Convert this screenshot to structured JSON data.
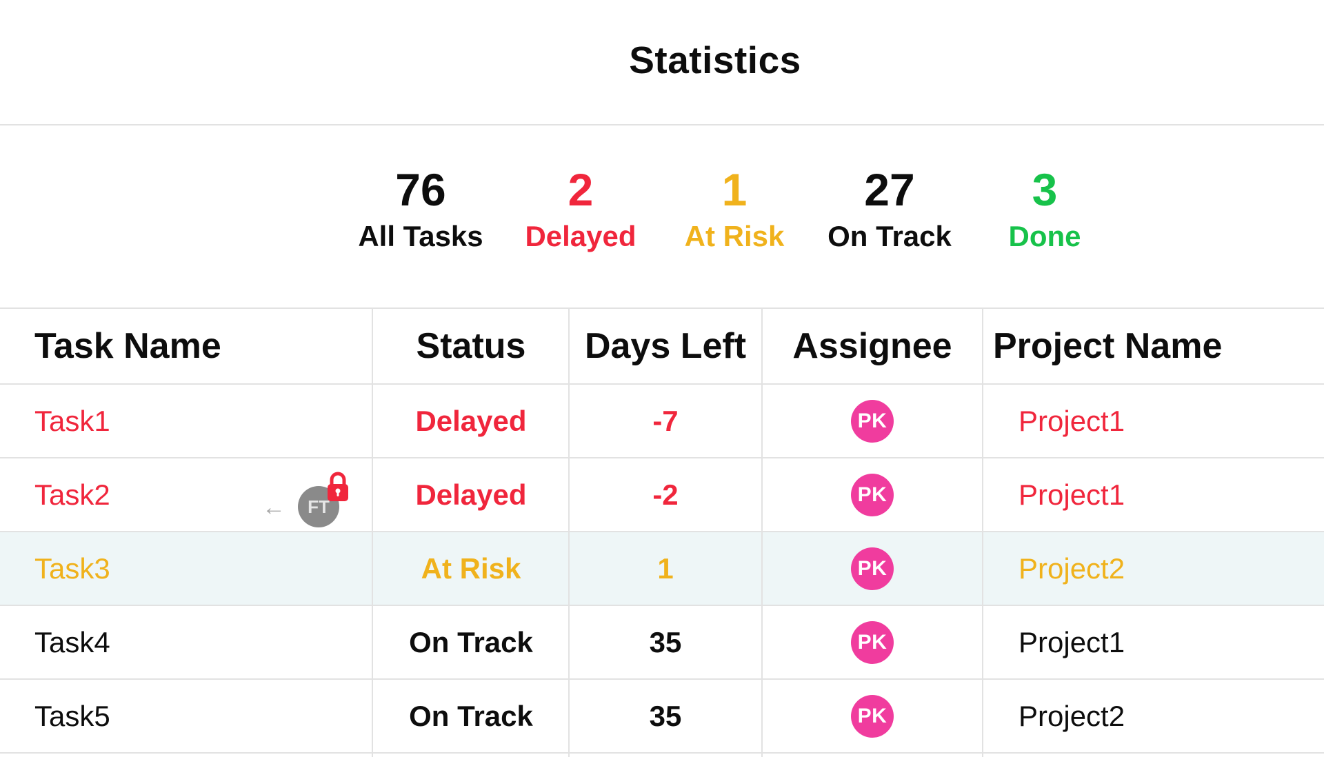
{
  "title": "Statistics",
  "colors": {
    "delayed": "#f0263c",
    "at_risk": "#f0b21c",
    "done": "#17c24a",
    "default": "#0d0d0d",
    "avatar": "#f03c9e",
    "highlight_row": "#eef6f7"
  },
  "stats": [
    {
      "value": "76",
      "label": "All Tasks"
    },
    {
      "value": "2",
      "label": "Delayed"
    },
    {
      "value": "1",
      "label": "At Risk"
    },
    {
      "value": "27",
      "label": "On Track"
    },
    {
      "value": "3",
      "label": "Done"
    }
  ],
  "table": {
    "columns": [
      "Task Name",
      "Status",
      "Days Left",
      "Assignee",
      "Project Name"
    ],
    "rows": [
      {
        "task": "Task1",
        "status": "Delayed",
        "days_left": "-7",
        "assignee": "PK",
        "project": "Project1"
      },
      {
        "task": "Task2",
        "status": "Delayed",
        "days_left": "-2",
        "assignee": "PK",
        "project": "Project1",
        "dependency_badge": "FT"
      },
      {
        "task": "Task3",
        "status": "At Risk",
        "days_left": "1",
        "assignee": "PK",
        "project": "Project2"
      },
      {
        "task": "Task4",
        "status": "On Track",
        "days_left": "35",
        "assignee": "PK",
        "project": "Project1"
      },
      {
        "task": "Task5",
        "status": "On Track",
        "days_left": "35",
        "assignee": "PK",
        "project": "Project2"
      }
    ]
  },
  "icons": {
    "dependency_arrow": "arrow-left-icon",
    "lock": "lock-icon"
  }
}
